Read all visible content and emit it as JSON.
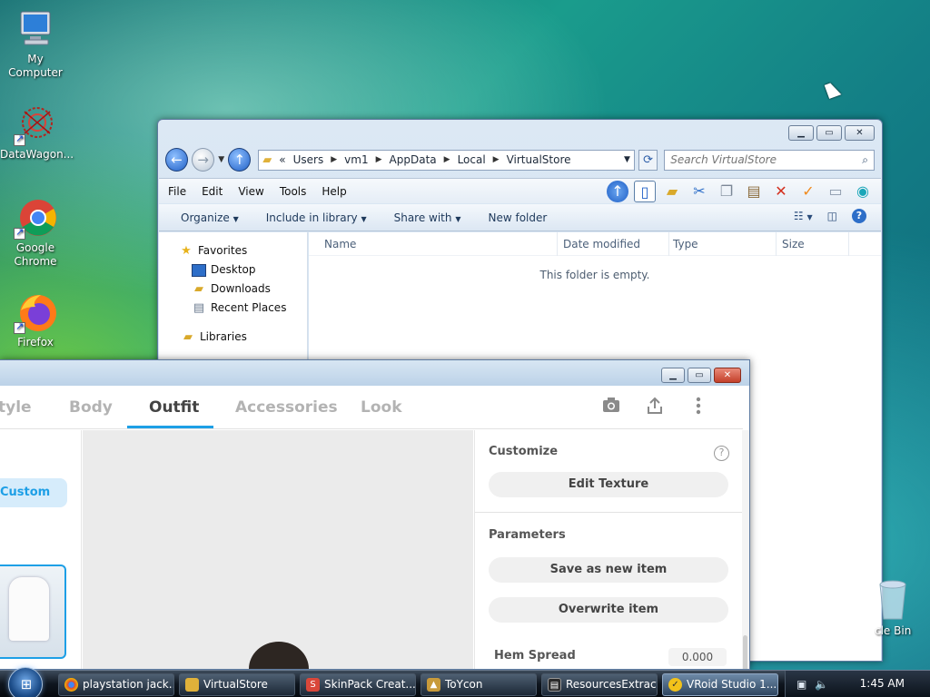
{
  "desktop": {
    "icons": [
      {
        "label": "My Computer",
        "icon": "computer-icon"
      },
      {
        "label": "DataWagon...",
        "icon": "datawagon-icon"
      },
      {
        "label": "Google Chrome",
        "icon": "chrome-icon"
      },
      {
        "label": "Firefox",
        "icon": "firefox-icon"
      }
    ],
    "recycle_bin_label": "cle Bin"
  },
  "explorer": {
    "address": {
      "prefix": "«",
      "crumbs": [
        "Users",
        "vm1",
        "AppData",
        "Local",
        "VirtualStore"
      ]
    },
    "search_placeholder": "Search VirtualStore",
    "menu": [
      "File",
      "Edit",
      "View",
      "Tools",
      "Help"
    ],
    "commands": [
      "Organize",
      "Include in library",
      "Share with",
      "New folder"
    ],
    "nav": {
      "favorites_label": "Favorites",
      "favorites": [
        "Desktop",
        "Downloads",
        "Recent Places"
      ],
      "libraries_label": "Libraries"
    },
    "columns": [
      "Name",
      "Date modified",
      "Type",
      "Size"
    ],
    "empty_message": "This folder is empty."
  },
  "vroid": {
    "tabs": [
      "tyle",
      "Body",
      "Outfit",
      "Accessories",
      "Look"
    ],
    "active_tab": "Outfit",
    "custom_label": "Custom",
    "customize_title": "Customize",
    "edit_texture_label": "Edit Texture",
    "parameters_title": "Parameters",
    "save_new_label": "Save as new item",
    "overwrite_label": "Overwrite item",
    "hem_spread_label": "Hem Spread",
    "hem_spread_value": "0.000",
    "accent_color": "#1d9fe6"
  },
  "taskbar": {
    "buttons": [
      {
        "label": "playstation jack...",
        "icon": "chrome-icon"
      },
      {
        "label": "VirtualStore",
        "icon": "folder-icon"
      },
      {
        "label": "SkinPack Creat...",
        "icon": "skinpack-icon"
      },
      {
        "label": "ToYcon",
        "icon": "toycon-icon"
      },
      {
        "label": "ResourcesExtract",
        "icon": "resources-icon"
      },
      {
        "label": "VRoid Studio 1....",
        "icon": "vroid-icon"
      }
    ],
    "clock": "1:45 AM"
  }
}
